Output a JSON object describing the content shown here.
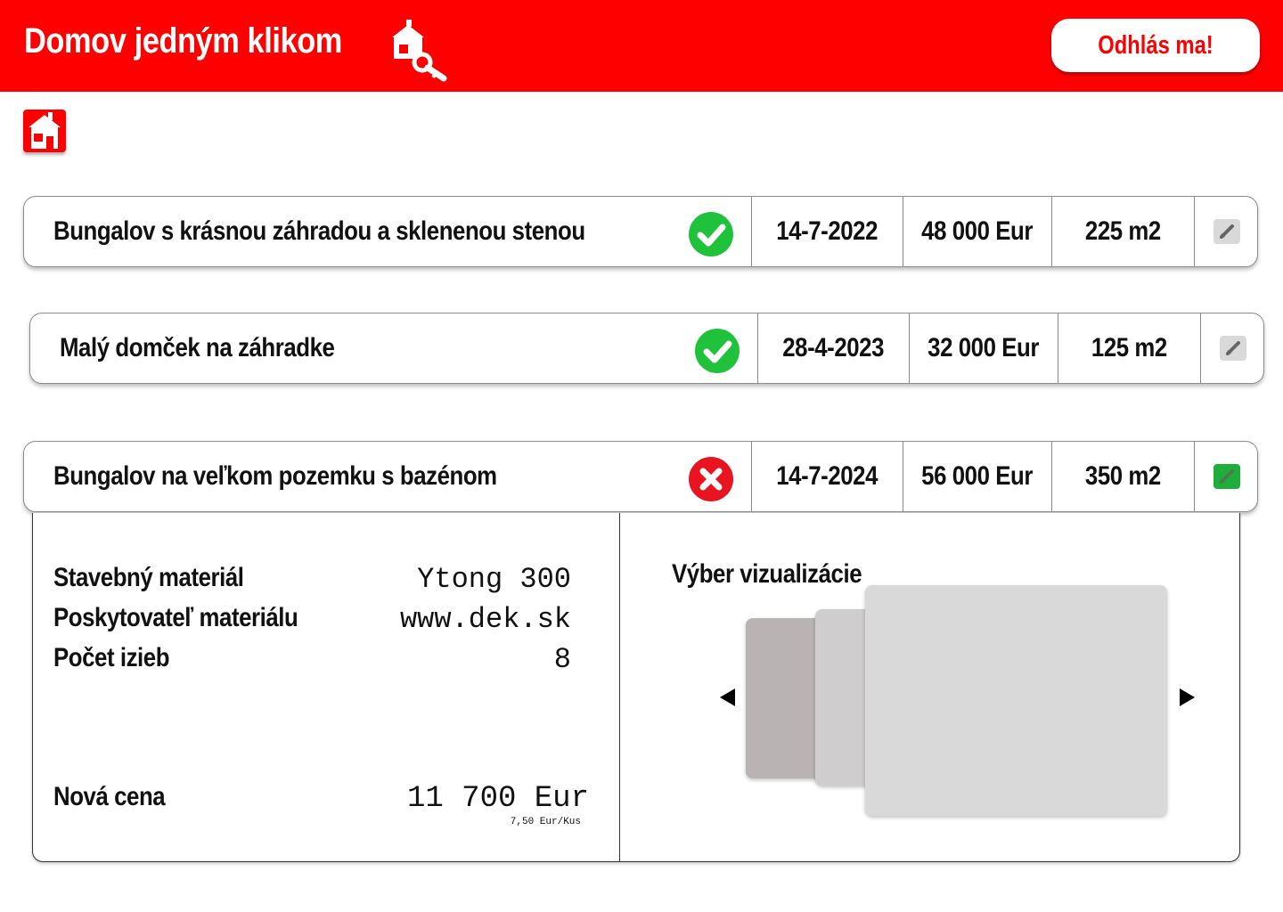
{
  "app": {
    "title": "Domov jedným klikom",
    "logout_label": "Odhlás ma!",
    "brand_color": "#fe0000"
  },
  "icons": {
    "brand": "house-key-icon",
    "home": "house-icon",
    "status_ok": "check-circle-icon",
    "status_fail": "x-circle-icon",
    "edit": "pencil-icon"
  },
  "listings": [
    {
      "title": "Bungalov s krásnou záhradou a sklenenou stenou",
      "status": "approved",
      "date": "14-7-2022",
      "price": "48 000 Eur",
      "area": "225 m2"
    },
    {
      "title": "Malý domček na záhradke",
      "status": "approved",
      "date": "28-4-2023",
      "price": "32 000 Eur",
      "area": "125 m2"
    },
    {
      "title": "Bungalov na veľkom pozemku s bazénom",
      "status": "rejected",
      "date": "14-7-2024",
      "price": "56 000 Eur",
      "area": "350 m2",
      "expanded": true
    }
  ],
  "status_colors": {
    "approved": "#1fc23a",
    "rejected": "#e8141f",
    "edit_active": "#1fae3c",
    "edit_inactive": "#d9d9d9"
  },
  "detail": {
    "specs": [
      {
        "label": "Stavebný materiál",
        "value": "Ytong 300"
      },
      {
        "label": "Poskytovateľ materiálu",
        "value": "www.dek.sk"
      },
      {
        "label": "Počet izieb",
        "value": "8"
      }
    ],
    "price_label": "Nová cena",
    "price_value": "11 700 Eur",
    "price_unit": "7,50 Eur/Kus",
    "visual_title": "Výber vizualizácie"
  }
}
